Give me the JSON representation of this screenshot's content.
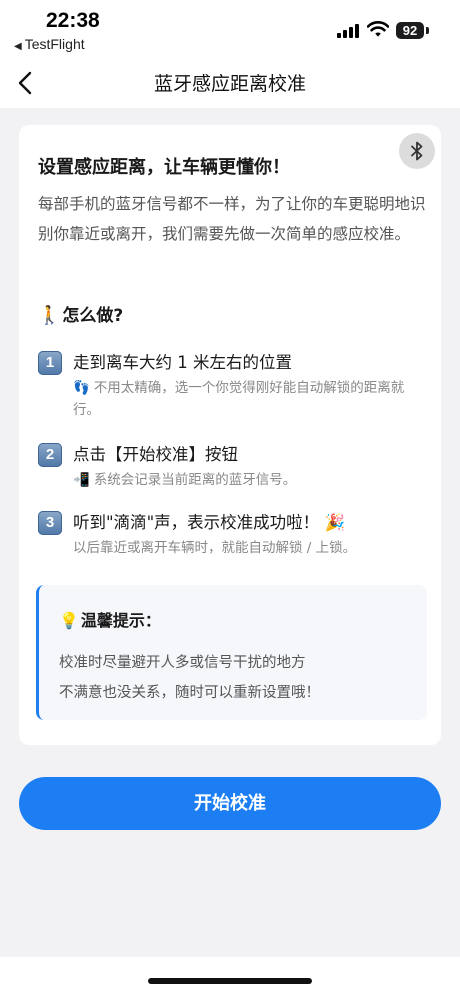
{
  "status": {
    "time": "22:38",
    "back_app": "TestFlight",
    "battery": "92"
  },
  "nav": {
    "title": "蓝牙感应距离校准"
  },
  "card": {
    "title": "设置感应距离，让车辆更懂你！",
    "intro": "每部手机的蓝牙信号都不一样，为了让你的车更聪明地识别你靠近或离开，我们需要先做一次简单的感应校准。",
    "howto_emoji": "🚶",
    "howto_title": "怎么做?",
    "steps": [
      {
        "num": "1",
        "title": "走到离车大约 1 米左右的位置",
        "emoji": "👣",
        "desc": "不用太精确，选一个你觉得刚好能自动解锁的距离就行。"
      },
      {
        "num": "2",
        "title": "点击【开始校准】按钮",
        "emoji": "📲",
        "desc": "系统会记录当前距离的蓝牙信号。"
      },
      {
        "num": "3",
        "title": "听到\"滴滴\"声，表示校准成功啦！",
        "emoji": "🎉",
        "desc": "以后靠近或离开车辆时，就能自动解锁 / 上锁。"
      }
    ],
    "tip": {
      "emoji": "💡",
      "title": "温馨提示：",
      "lines": [
        "校准时尽量避开人多或信号干扰的地方",
        "不满意也没关系，随时可以重新设置哦！"
      ]
    }
  },
  "actions": {
    "start_label": "开始校准"
  },
  "colors": {
    "accent": "#1c7ef2",
    "tip_border": "#1f7ff0",
    "page_bg": "#f2f2f4"
  },
  "icons": {
    "back": "chevron-left-icon",
    "bluetooth": "bluetooth-icon",
    "signal": "cellular-signal-icon",
    "wifi": "wifi-icon",
    "battery": "battery-icon"
  }
}
